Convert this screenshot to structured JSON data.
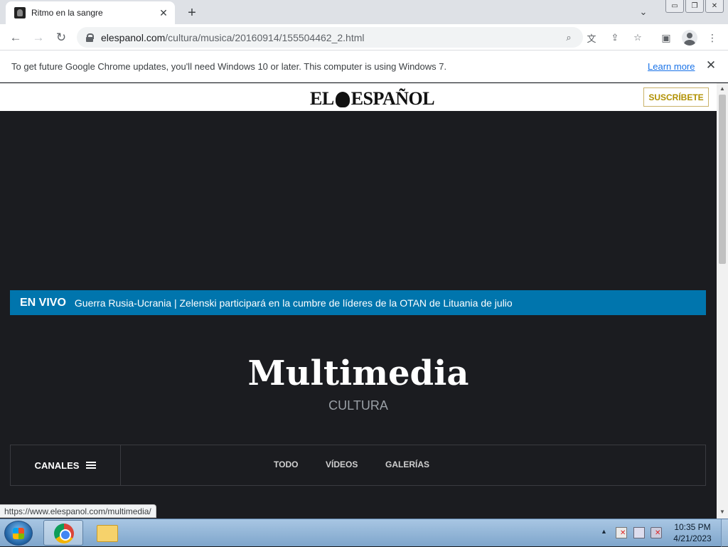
{
  "browser": {
    "tab": {
      "title": "Ritmo en la sangre",
      "close": "✕"
    },
    "new_tab": "+",
    "tab_search": "⌄",
    "window_buttons": {
      "minimize": "▭",
      "restore": "❐",
      "close": "✕"
    },
    "nav": {
      "back": "←",
      "forward": "→",
      "reload": "↻"
    },
    "url": {
      "host": "elespanol.com",
      "path": "/cultura/musica/20160914/155504462_2.html"
    },
    "omnibox_icons": {
      "search": "⌕",
      "translate": "文",
      "share": "⇪",
      "bookmark": "☆"
    },
    "toolbar_icons": {
      "side_panel": "▣",
      "menu": "⋮"
    }
  },
  "infobar": {
    "message": "To get future Google Chrome updates, you'll need Windows 10 or later. This computer is using Windows 7.",
    "link": "Learn more",
    "close": "✕"
  },
  "site": {
    "logo_left": "EL",
    "logo_right": "ESPAÑOL",
    "subscribe_label": "SUSCRÍBETE",
    "live": {
      "label": "EN VIVO",
      "headline": "Guerra Rusia-Ucrania | Zelenski participará en la cumbre de líderes de la OTAN de Lituania de julio"
    },
    "section": {
      "title": "Multimedia",
      "subtitle": "CULTURA"
    },
    "channels": {
      "label": "CANALES",
      "links": [
        "TODO",
        "VÍDEOS",
        "GALERÍAS"
      ]
    },
    "status_url": "https://www.elespanol.com/multimedia/"
  },
  "scrollbar": {
    "up": "▲",
    "down": "▼"
  },
  "taskbar": {
    "time": "10:35 PM",
    "date": "4/21/2023",
    "tray_arrow": "▲"
  }
}
